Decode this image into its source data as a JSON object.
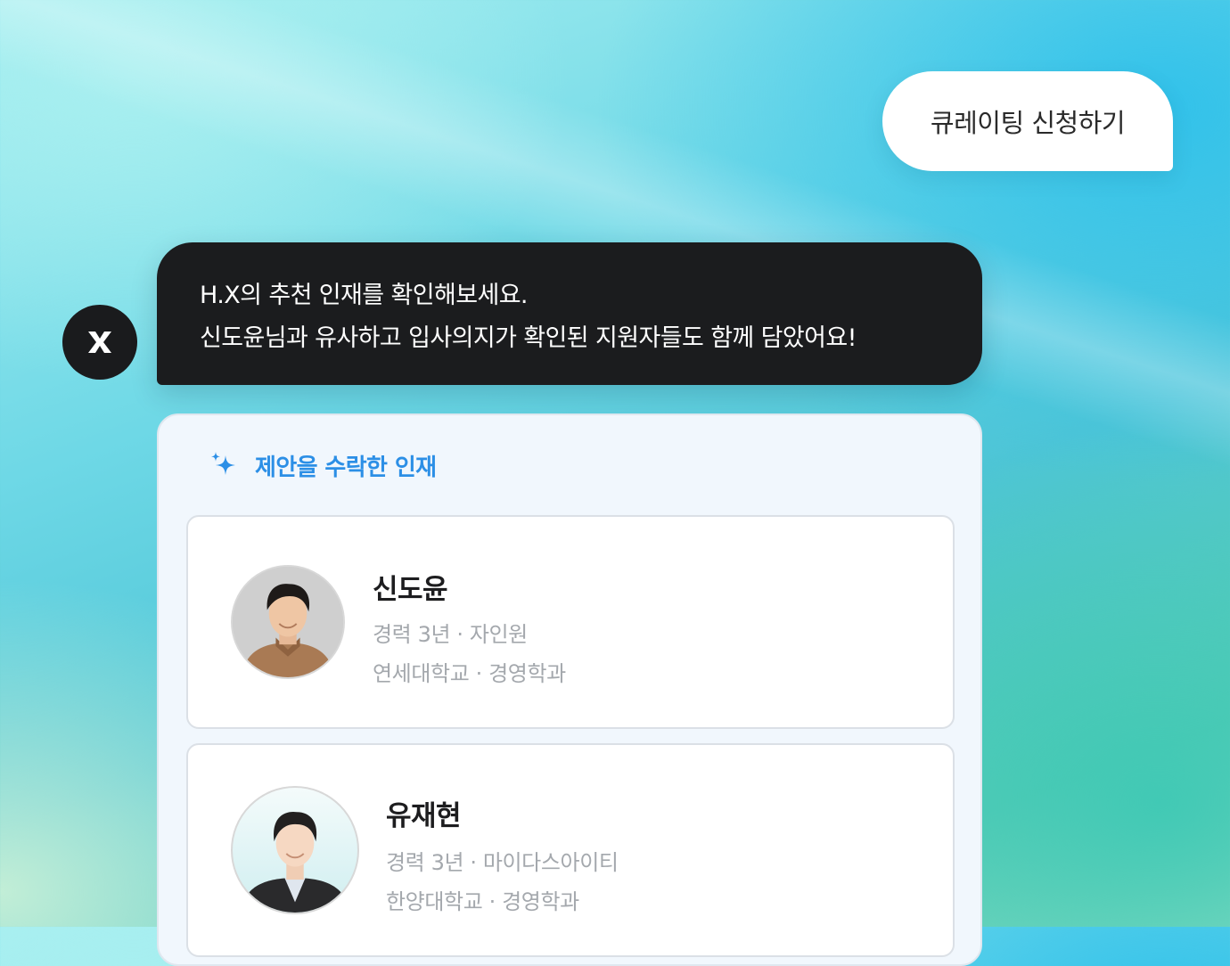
{
  "user_message": "큐레이팅 신청하기",
  "bot": {
    "avatar_icon": "x-logo-icon",
    "line1": "H.X의 추천 인재를 확인해보세요.",
    "line2": "신도윤님과 유사하고 입사의지가 확인된 지원자들도 함께 담았어요!"
  },
  "panel": {
    "icon": "sparkle-icon",
    "title": "제안을 수락한 인재",
    "accent_color": "#2c8fe6",
    "candidates": [
      {
        "name": "신도윤",
        "career": "경력 3년 · 자인원",
        "education": "연세대학교 · 경영학과"
      },
      {
        "name": "유재현",
        "career": "경력 3년 · 마이다스아이티",
        "education": "한양대학교 · 경영학과"
      }
    ]
  }
}
